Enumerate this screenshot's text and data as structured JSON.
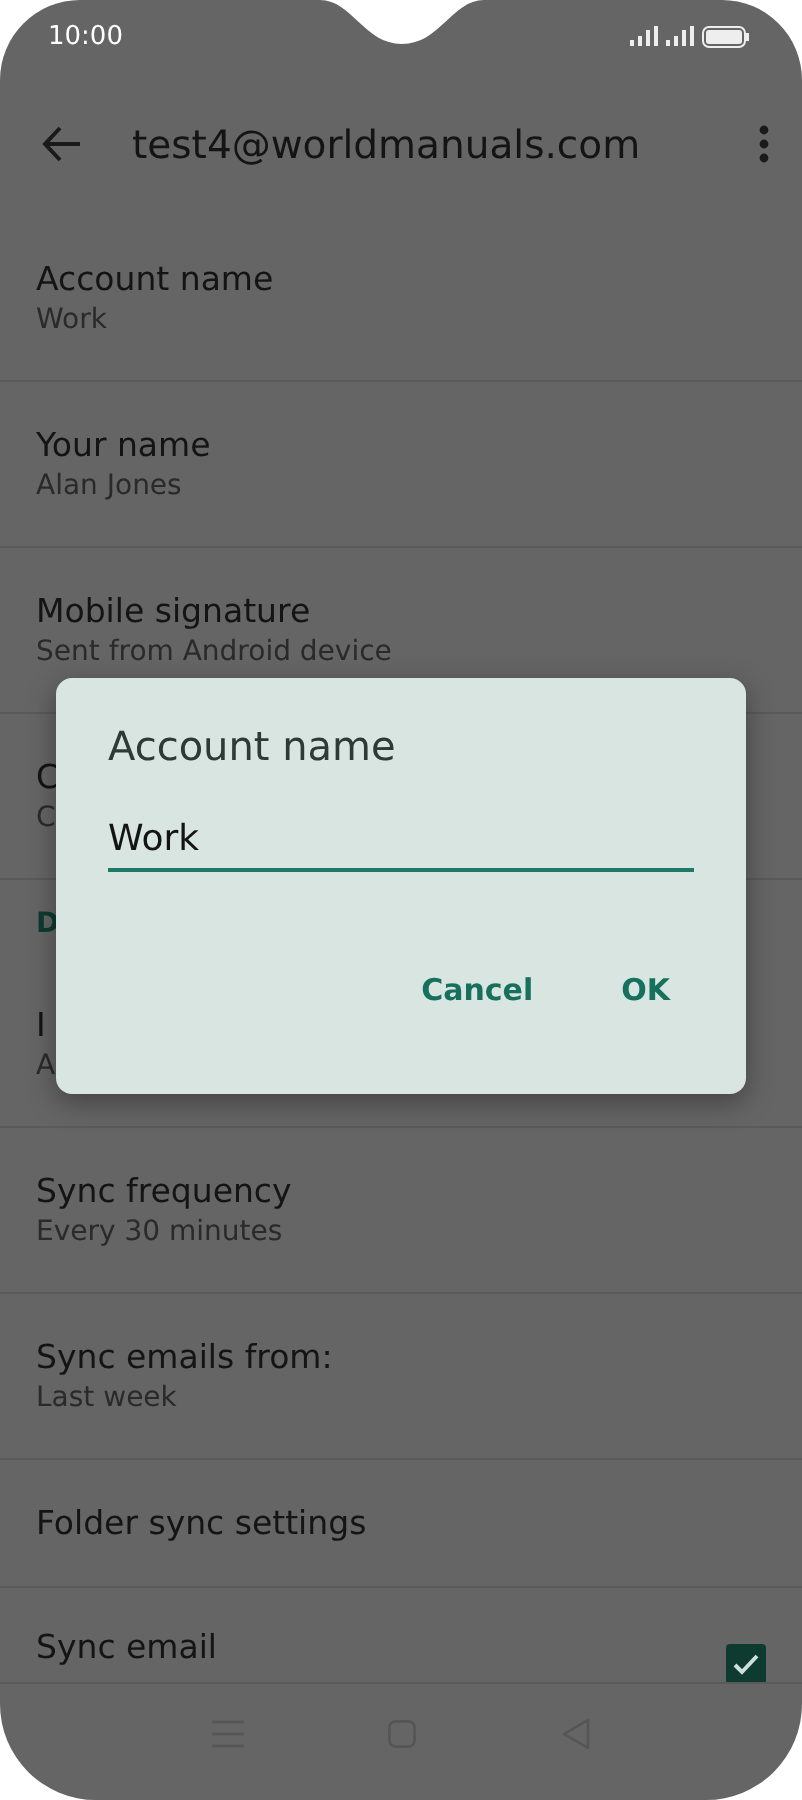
{
  "status_bar": {
    "time": "10:00"
  },
  "app_bar": {
    "title": "test4@worldmanuals.com"
  },
  "settings": [
    {
      "kind": "item",
      "title": "Account name",
      "subtitle": "Work"
    },
    {
      "kind": "item",
      "title": "Your name",
      "subtitle": "Alan Jones"
    },
    {
      "kind": "item",
      "title": "Mobile signature",
      "subtitle": "Sent from Android device"
    },
    {
      "kind": "item",
      "title": "C",
      "subtitle": "C"
    },
    {
      "kind": "header",
      "title": "D"
    },
    {
      "kind": "item",
      "title": "I",
      "subtitle": "A"
    },
    {
      "kind": "item",
      "title": "Sync frequency",
      "subtitle": "Every 30 minutes"
    },
    {
      "kind": "item",
      "title": "Sync emails from:",
      "subtitle": "Last week"
    },
    {
      "kind": "item",
      "title": "Folder sync settings"
    },
    {
      "kind": "checkbox",
      "title": "Sync email",
      "checked": true
    }
  ],
  "dialog": {
    "title": "Account name",
    "field": {
      "value": "Work"
    },
    "buttons": [
      "Cancel",
      "OK"
    ]
  }
}
